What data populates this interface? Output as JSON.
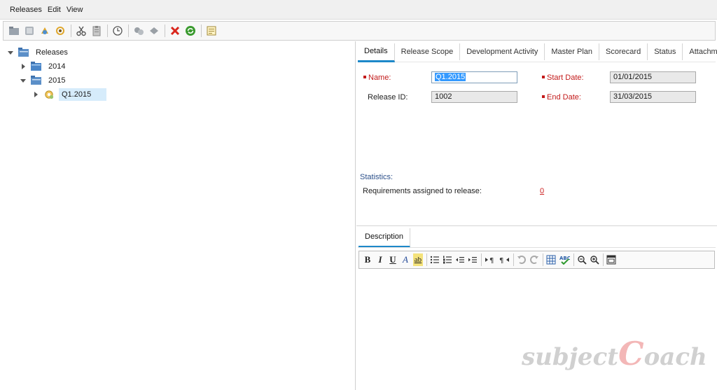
{
  "menubar": {
    "items": [
      "Releases",
      "Edit",
      "View"
    ]
  },
  "toolbar": {
    "buttons": [
      "new-folder-icon",
      "new-release-icon",
      "new-cycle-icon",
      "refresh-cycle-icon",
      "cut-icon",
      "paste-icon",
      "clock-icon",
      "assign-icon",
      "move-icon",
      "delete-icon",
      "refresh-icon",
      "details-icon"
    ]
  },
  "tree": {
    "root": "Releases",
    "folder_2014": "2014",
    "folder_2015": "2015",
    "release_q1": "Q1.2015"
  },
  "tabs": [
    "Details",
    "Release Scope",
    "Development Activity",
    "Master Plan",
    "Scorecard",
    "Status",
    "Attachments"
  ],
  "details": {
    "name_label": "Name:",
    "name_value": "Q1.2015",
    "release_id_label": "Release ID:",
    "release_id_value": "1002",
    "start_date_label": "Start Date:",
    "start_date_value": "01/01/2015",
    "end_date_label": "End Date:",
    "end_date_value": "31/03/2015"
  },
  "statistics": {
    "title": "Statistics:",
    "req_label": "Requirements assigned to release:",
    "req_value": "0"
  },
  "description": {
    "tab_label": "Description"
  },
  "editor_toolbar": {
    "bold": "B",
    "italic": "I",
    "underline": "U",
    "font_color": "A",
    "highlight": "ab"
  },
  "watermark": {
    "part1": "subject",
    "part2": "C",
    "part3": "oach"
  },
  "colors": {
    "accent": "#1d88c9",
    "required": "#c31a1a",
    "selection": "#d6ecfb"
  }
}
